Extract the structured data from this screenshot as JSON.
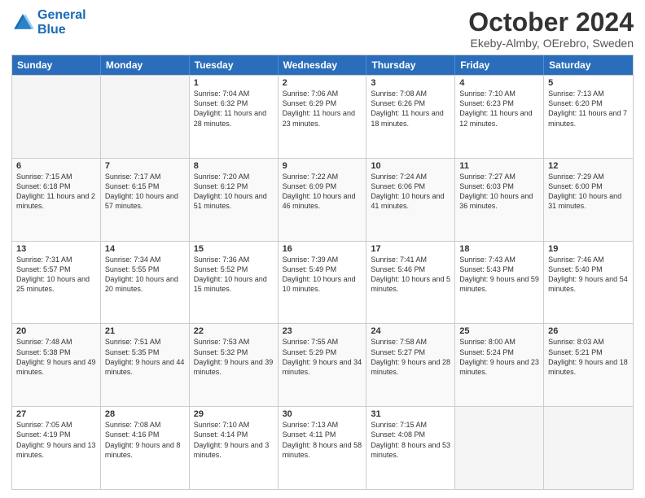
{
  "header": {
    "logo_line1": "General",
    "logo_line2": "Blue",
    "month_title": "October 2024",
    "location": "Ekeby-Almby, OErebro, Sweden"
  },
  "days_of_week": [
    "Sunday",
    "Monday",
    "Tuesday",
    "Wednesday",
    "Thursday",
    "Friday",
    "Saturday"
  ],
  "rows": [
    [
      {
        "day": "",
        "info": ""
      },
      {
        "day": "",
        "info": ""
      },
      {
        "day": "1",
        "info": "Sunrise: 7:04 AM\nSunset: 6:32 PM\nDaylight: 11 hours and 28 minutes."
      },
      {
        "day": "2",
        "info": "Sunrise: 7:06 AM\nSunset: 6:29 PM\nDaylight: 11 hours and 23 minutes."
      },
      {
        "day": "3",
        "info": "Sunrise: 7:08 AM\nSunset: 6:26 PM\nDaylight: 11 hours and 18 minutes."
      },
      {
        "day": "4",
        "info": "Sunrise: 7:10 AM\nSunset: 6:23 PM\nDaylight: 11 hours and 12 minutes."
      },
      {
        "day": "5",
        "info": "Sunrise: 7:13 AM\nSunset: 6:20 PM\nDaylight: 11 hours and 7 minutes."
      }
    ],
    [
      {
        "day": "6",
        "info": "Sunrise: 7:15 AM\nSunset: 6:18 PM\nDaylight: 11 hours and 2 minutes."
      },
      {
        "day": "7",
        "info": "Sunrise: 7:17 AM\nSunset: 6:15 PM\nDaylight: 10 hours and 57 minutes."
      },
      {
        "day": "8",
        "info": "Sunrise: 7:20 AM\nSunset: 6:12 PM\nDaylight: 10 hours and 51 minutes."
      },
      {
        "day": "9",
        "info": "Sunrise: 7:22 AM\nSunset: 6:09 PM\nDaylight: 10 hours and 46 minutes."
      },
      {
        "day": "10",
        "info": "Sunrise: 7:24 AM\nSunset: 6:06 PM\nDaylight: 10 hours and 41 minutes."
      },
      {
        "day": "11",
        "info": "Sunrise: 7:27 AM\nSunset: 6:03 PM\nDaylight: 10 hours and 36 minutes."
      },
      {
        "day": "12",
        "info": "Sunrise: 7:29 AM\nSunset: 6:00 PM\nDaylight: 10 hours and 31 minutes."
      }
    ],
    [
      {
        "day": "13",
        "info": "Sunrise: 7:31 AM\nSunset: 5:57 PM\nDaylight: 10 hours and 25 minutes."
      },
      {
        "day": "14",
        "info": "Sunrise: 7:34 AM\nSunset: 5:55 PM\nDaylight: 10 hours and 20 minutes."
      },
      {
        "day": "15",
        "info": "Sunrise: 7:36 AM\nSunset: 5:52 PM\nDaylight: 10 hours and 15 minutes."
      },
      {
        "day": "16",
        "info": "Sunrise: 7:39 AM\nSunset: 5:49 PM\nDaylight: 10 hours and 10 minutes."
      },
      {
        "day": "17",
        "info": "Sunrise: 7:41 AM\nSunset: 5:46 PM\nDaylight: 10 hours and 5 minutes."
      },
      {
        "day": "18",
        "info": "Sunrise: 7:43 AM\nSunset: 5:43 PM\nDaylight: 9 hours and 59 minutes."
      },
      {
        "day": "19",
        "info": "Sunrise: 7:46 AM\nSunset: 5:40 PM\nDaylight: 9 hours and 54 minutes."
      }
    ],
    [
      {
        "day": "20",
        "info": "Sunrise: 7:48 AM\nSunset: 5:38 PM\nDaylight: 9 hours and 49 minutes."
      },
      {
        "day": "21",
        "info": "Sunrise: 7:51 AM\nSunset: 5:35 PM\nDaylight: 9 hours and 44 minutes."
      },
      {
        "day": "22",
        "info": "Sunrise: 7:53 AM\nSunset: 5:32 PM\nDaylight: 9 hours and 39 minutes."
      },
      {
        "day": "23",
        "info": "Sunrise: 7:55 AM\nSunset: 5:29 PM\nDaylight: 9 hours and 34 minutes."
      },
      {
        "day": "24",
        "info": "Sunrise: 7:58 AM\nSunset: 5:27 PM\nDaylight: 9 hours and 28 minutes."
      },
      {
        "day": "25",
        "info": "Sunrise: 8:00 AM\nSunset: 5:24 PM\nDaylight: 9 hours and 23 minutes."
      },
      {
        "day": "26",
        "info": "Sunrise: 8:03 AM\nSunset: 5:21 PM\nDaylight: 9 hours and 18 minutes."
      }
    ],
    [
      {
        "day": "27",
        "info": "Sunrise: 7:05 AM\nSunset: 4:19 PM\nDaylight: 9 hours and 13 minutes."
      },
      {
        "day": "28",
        "info": "Sunrise: 7:08 AM\nSunset: 4:16 PM\nDaylight: 9 hours and 8 minutes."
      },
      {
        "day": "29",
        "info": "Sunrise: 7:10 AM\nSunset: 4:14 PM\nDaylight: 9 hours and 3 minutes."
      },
      {
        "day": "30",
        "info": "Sunrise: 7:13 AM\nSunset: 4:11 PM\nDaylight: 8 hours and 58 minutes."
      },
      {
        "day": "31",
        "info": "Sunrise: 7:15 AM\nSunset: 4:08 PM\nDaylight: 8 hours and 53 minutes."
      },
      {
        "day": "",
        "info": ""
      },
      {
        "day": "",
        "info": ""
      }
    ]
  ]
}
